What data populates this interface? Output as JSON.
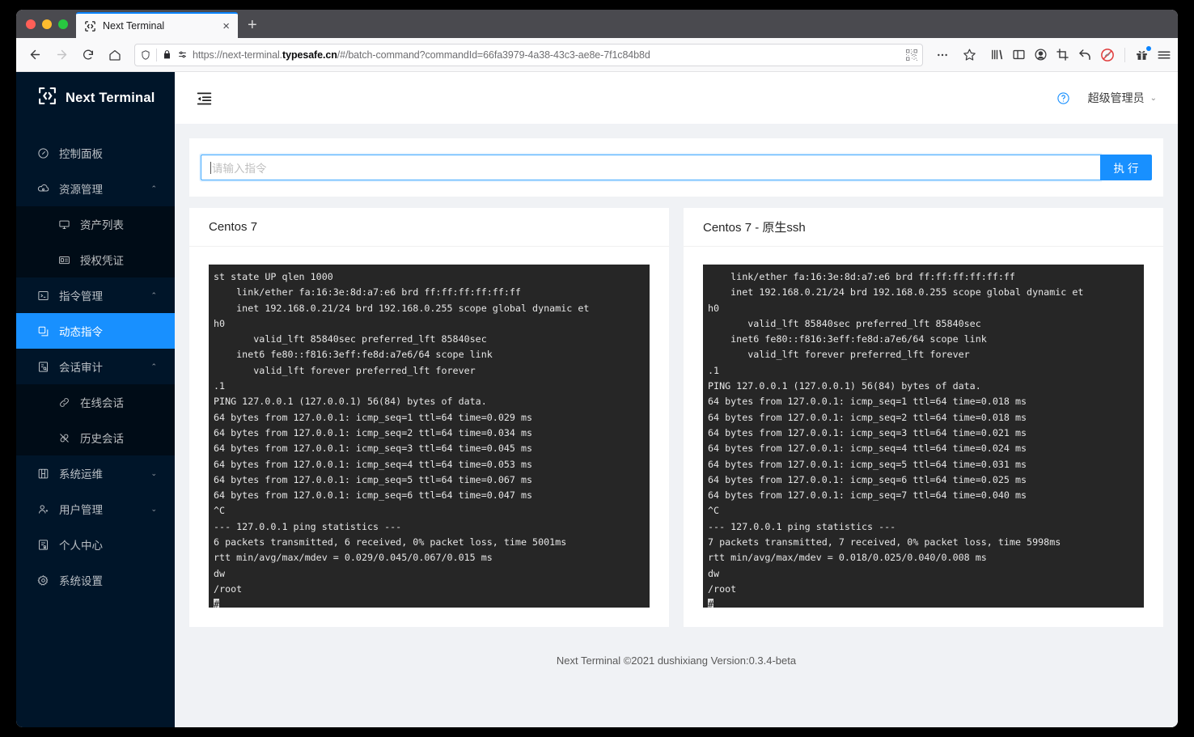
{
  "browser": {
    "tab": {
      "title": "Next Terminal",
      "favicon": "next-terminal-logo-icon",
      "close": "×"
    },
    "new_tab_label": "+",
    "url_display_prefix": "https://next-terminal.",
    "url_display_bold": "typesafe.cn",
    "url_display_suffix": "/#/batch-command?commandId=66fa3979-4a38-43c3-ae8e-7f1c84b8d",
    "url_full": "https://next-terminal.typesafe.cn/#/batch-command?commandId=66fa3979-4a38-43c3-ae8e-7f1c84b8d",
    "nav": {
      "back": "←",
      "forward": "→",
      "reload": "↻",
      "home": "⌂"
    },
    "toolbar_icons": [
      "library-icon",
      "sidebar-icon",
      "account-icon",
      "screenshot-icon",
      "undo-icon",
      "blocked-icon",
      "gift-icon",
      "app-menu-icon"
    ],
    "urlbar_icons": [
      "shield-icon",
      "lock-icon",
      "permissions-icon",
      "qr-icon",
      "page-actions-icon",
      "bookmark-star-icon"
    ]
  },
  "sidebar": {
    "brand": "Next Terminal",
    "items": [
      {
        "label": "控制面板",
        "icon": "dashboard-icon",
        "level": 1,
        "arrow": "",
        "active": false
      },
      {
        "label": "资源管理",
        "icon": "cloud-server-icon",
        "level": 1,
        "arrow": "⌃",
        "active": false
      },
      {
        "label": "资产列表",
        "icon": "desktop-icon",
        "level": 2,
        "arrow": "",
        "active": false
      },
      {
        "label": "授权凭证",
        "icon": "id-card-icon",
        "level": 2,
        "arrow": "",
        "active": false
      },
      {
        "label": "指令管理",
        "icon": "code-square-icon",
        "level": 1,
        "arrow": "⌃",
        "active": false
      },
      {
        "label": "动态指令",
        "icon": "copy-icon",
        "level": 2,
        "arrow": "",
        "active": true
      },
      {
        "label": "会话审计",
        "icon": "audit-icon",
        "level": 1,
        "arrow": "⌃",
        "active": false
      },
      {
        "label": "在线会话",
        "icon": "link-icon",
        "level": 2,
        "arrow": "",
        "active": false
      },
      {
        "label": "历史会话",
        "icon": "disconnect-icon",
        "level": 2,
        "arrow": "",
        "active": false
      },
      {
        "label": "系统运维",
        "icon": "tool-box-icon",
        "level": 1,
        "arrow": "⌄",
        "active": false
      },
      {
        "label": "用户管理",
        "icon": "user-icon",
        "level": 1,
        "arrow": "⌄",
        "active": false
      },
      {
        "label": "个人中心",
        "icon": "profile-icon",
        "level": 1,
        "arrow": "",
        "active": false
      },
      {
        "label": "系统设置",
        "icon": "setting-gear-icon",
        "level": 1,
        "arrow": "",
        "active": false
      }
    ]
  },
  "header": {
    "fold_icon": "menu-fold-icon",
    "help_icon": "question-circle-icon",
    "user_name": "超级管理员",
    "user_caret": "⌄"
  },
  "command_bar": {
    "input_value": "",
    "placeholder": "请输入指令",
    "execute_label": "执行"
  },
  "cards": [
    {
      "title": "Centos 7",
      "terminal": "st state UP qlen 1000\n    link/ether fa:16:3e:8d:a7:e6 brd ff:ff:ff:ff:ff:ff\n    inet 192.168.0.21/24 brd 192.168.0.255 scope global dynamic et\nh0\n       valid_lft 85840sec preferred_lft 85840sec\n    inet6 fe80::f816:3eff:fe8d:a7e6/64 scope link\n       valid_lft forever preferred_lft forever\n.1\nPING 127.0.0.1 (127.0.0.1) 56(84) bytes of data.\n64 bytes from 127.0.0.1: icmp_seq=1 ttl=64 time=0.029 ms\n64 bytes from 127.0.0.1: icmp_seq=2 ttl=64 time=0.034 ms\n64 bytes from 127.0.0.1: icmp_seq=3 ttl=64 time=0.045 ms\n64 bytes from 127.0.0.1: icmp_seq=4 ttl=64 time=0.053 ms\n64 bytes from 127.0.0.1: icmp_seq=5 ttl=64 time=0.067 ms\n64 bytes from 127.0.0.1: icmp_seq=6 ttl=64 time=0.047 ms\n^C\n--- 127.0.0.1 ping statistics ---\n6 packets transmitted, 6 received, 0% packet loss, time 5001ms\nrtt min/avg/max/mdev = 0.029/0.045/0.067/0.015 ms\ndw\n/root\n",
      "prompt": "#"
    },
    {
      "title": "Centos 7 - 原生ssh",
      "terminal": "    link/ether fa:16:3e:8d:a7:e6 brd ff:ff:ff:ff:ff:ff\n    inet 192.168.0.21/24 brd 192.168.0.255 scope global dynamic et\nh0\n       valid_lft 85840sec preferred_lft 85840sec\n    inet6 fe80::f816:3eff:fe8d:a7e6/64 scope link\n       valid_lft forever preferred_lft forever\n.1\nPING 127.0.0.1 (127.0.0.1) 56(84) bytes of data.\n64 bytes from 127.0.0.1: icmp_seq=1 ttl=64 time=0.018 ms\n64 bytes from 127.0.0.1: icmp_seq=2 ttl=64 time=0.018 ms\n64 bytes from 127.0.0.1: icmp_seq=3 ttl=64 time=0.021 ms\n64 bytes from 127.0.0.1: icmp_seq=4 ttl=64 time=0.024 ms\n64 bytes from 127.0.0.1: icmp_seq=5 ttl=64 time=0.031 ms\n64 bytes from 127.0.0.1: icmp_seq=6 ttl=64 time=0.025 ms\n64 bytes from 127.0.0.1: icmp_seq=7 ttl=64 time=0.040 ms\n^C\n--- 127.0.0.1 ping statistics ---\n7 packets transmitted, 7 received, 0% packet loss, time 5998ms\nrtt min/avg/max/mdev = 0.018/0.025/0.040/0.008 ms\ndw\n/root\n",
      "prompt": "#"
    }
  ],
  "footer": "Next Terminal ©2021 dushixiang Version:0.3.4-beta",
  "colors": {
    "accent": "#1890ff",
    "sidebar_bg": "#001529",
    "sidebar_sub_bg": "#000c17",
    "page_bg": "#f0f2f5",
    "terminal_bg": "#262626",
    "terminal_fg": "#e6e6e6"
  }
}
